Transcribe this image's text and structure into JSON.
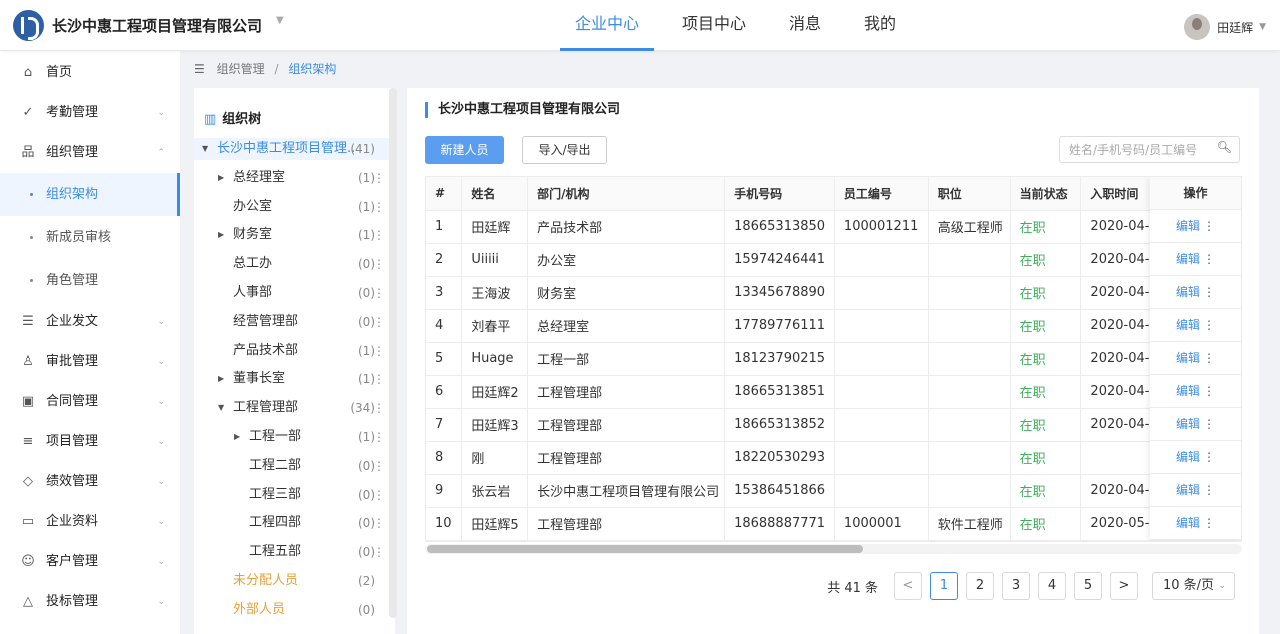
{
  "header": {
    "company": "长沙中惠工程项目管理有限公司",
    "nav": [
      "企业中心",
      "项目中心",
      "消息",
      "我的"
    ],
    "active_nav": 0,
    "user_name": "田廷辉"
  },
  "sidebar": {
    "items": [
      {
        "label": "首页",
        "icon": "home-icon",
        "glyph": "⌂",
        "arrow": ""
      },
      {
        "label": "考勤管理",
        "icon": "check-circle-icon",
        "glyph": "✓",
        "arrow": "⌄"
      },
      {
        "label": "组织管理",
        "icon": "org-chart-icon",
        "glyph": "品",
        "arrow": "⌃"
      }
    ],
    "sub_items": [
      {
        "label": "组织架构",
        "active": true
      },
      {
        "label": "新成员审核",
        "active": false
      },
      {
        "label": "角色管理",
        "active": false
      }
    ],
    "items_after": [
      {
        "label": "企业发文",
        "icon": "document-icon",
        "glyph": "☰",
        "arrow": "⌄"
      },
      {
        "label": "审批管理",
        "icon": "stamp-icon",
        "glyph": "♙",
        "arrow": "⌄"
      },
      {
        "label": "合同管理",
        "icon": "contract-icon",
        "glyph": "▣",
        "arrow": "⌄"
      },
      {
        "label": "项目管理",
        "icon": "list-icon",
        "glyph": "≡",
        "arrow": "⌄"
      },
      {
        "label": "绩效管理",
        "icon": "diamond-icon",
        "glyph": "◇",
        "arrow": "⌄"
      },
      {
        "label": "企业资料",
        "icon": "folder-icon",
        "glyph": "▭",
        "arrow": "⌄"
      },
      {
        "label": "客户管理",
        "icon": "customer-icon",
        "glyph": "☺",
        "arrow": "⌄"
      },
      {
        "label": "投标管理",
        "icon": "warning-icon",
        "glyph": "△",
        "arrow": "⌄"
      }
    ]
  },
  "breadcrumb": {
    "parent": "组织管理",
    "separator": "/",
    "current": "组织架构"
  },
  "tree": {
    "title": "组织树",
    "nodes": [
      {
        "label": "长沙中惠工程项目管理..",
        "count": "(41)",
        "level": 0,
        "arrow": "▼",
        "active": true,
        "orange": false,
        "more": false
      },
      {
        "label": "总经理室",
        "count": "(1)",
        "level": 1,
        "arrow": "▶",
        "active": false,
        "orange": false,
        "more": true
      },
      {
        "label": "办公室",
        "count": "(1)",
        "level": 1,
        "arrow": "",
        "active": false,
        "orange": false,
        "more": true
      },
      {
        "label": "财务室",
        "count": "(1)",
        "level": 1,
        "arrow": "▶",
        "active": false,
        "orange": false,
        "more": true
      },
      {
        "label": "总工办",
        "count": "(0)",
        "level": 1,
        "arrow": "",
        "active": false,
        "orange": false,
        "more": true
      },
      {
        "label": "人事部",
        "count": "(0)",
        "level": 1,
        "arrow": "",
        "active": false,
        "orange": false,
        "more": true
      },
      {
        "label": "经营管理部",
        "count": "(0)",
        "level": 1,
        "arrow": "",
        "active": false,
        "orange": false,
        "more": true
      },
      {
        "label": "产品技术部",
        "count": "(1)",
        "level": 1,
        "arrow": "",
        "active": false,
        "orange": false,
        "more": true
      },
      {
        "label": "董事长室",
        "count": "(1)",
        "level": 1,
        "arrow": "▶",
        "active": false,
        "orange": false,
        "more": true
      },
      {
        "label": "工程管理部",
        "count": "(34)",
        "level": 1,
        "arrow": "▼",
        "active": false,
        "orange": false,
        "more": true
      },
      {
        "label": "工程一部",
        "count": "(1)",
        "level": 2,
        "arrow": "▶",
        "active": false,
        "orange": false,
        "more": true
      },
      {
        "label": "工程二部",
        "count": "(0)",
        "level": 2,
        "arrow": "",
        "active": false,
        "orange": false,
        "more": true
      },
      {
        "label": "工程三部",
        "count": "(0)",
        "level": 2,
        "arrow": "",
        "active": false,
        "orange": false,
        "more": true
      },
      {
        "label": "工程四部",
        "count": "(0)",
        "level": 2,
        "arrow": "",
        "active": false,
        "orange": false,
        "more": true
      },
      {
        "label": "工程五部",
        "count": "(0)",
        "level": 2,
        "arrow": "",
        "active": false,
        "orange": false,
        "more": true
      },
      {
        "label": "未分配人员",
        "count": "(2)",
        "level": 1,
        "arrow": "",
        "active": false,
        "orange": true,
        "more": false
      },
      {
        "label": "外部人员",
        "count": "(0)",
        "level": 1,
        "arrow": "",
        "active": false,
        "orange": true,
        "more": false
      }
    ]
  },
  "main": {
    "title": "长沙中惠工程项目管理有限公司",
    "new_button": "新建人员",
    "import_button": "导入/导出",
    "search_placeholder": "姓名/手机号码/员工编号",
    "columns": [
      "#",
      "姓名",
      "部门/机构",
      "手机号码",
      "员工编号",
      "职位",
      "当前状态",
      "入职时间"
    ],
    "op_column": "操作",
    "edit_label": "编辑",
    "more_label": "⋮",
    "rows": [
      [
        "1",
        "田廷辉",
        "产品技术部",
        "18665313850",
        "100001211",
        "高级工程师",
        "在职",
        "2020-04-"
      ],
      [
        "2",
        "Uiiiii",
        "办公室",
        "15974246441",
        "",
        "",
        "在职",
        "2020-04-"
      ],
      [
        "3",
        "王海波",
        "财务室",
        "13345678890",
        "",
        "",
        "在职",
        "2020-04-"
      ],
      [
        "4",
        "刘春平",
        "总经理室",
        "17789776111",
        "",
        "",
        "在职",
        "2020-04-"
      ],
      [
        "5",
        "Huage",
        "工程一部",
        "18123790215",
        "",
        "",
        "在职",
        "2020-04-"
      ],
      [
        "6",
        "田廷辉2",
        "工程管理部",
        "18665313851",
        "",
        "",
        "在职",
        "2020-04-"
      ],
      [
        "7",
        "田廷辉3",
        "工程管理部",
        "18665313852",
        "",
        "",
        "在职",
        "2020-04-"
      ],
      [
        "8",
        "刚",
        "工程管理部",
        "18220530293",
        "",
        "",
        "在职",
        ""
      ],
      [
        "9",
        "张云岩",
        "长沙中惠工程项目管理有限公司",
        "15386451866",
        "",
        "",
        "在职",
        "2020-04-"
      ],
      [
        "10",
        "田廷辉5",
        "工程管理部",
        "18688887771",
        "1000001",
        "软件工程师",
        "在职",
        "2020-05-"
      ]
    ]
  },
  "pagination": {
    "total": "共 41 条",
    "prev": "<",
    "next": ">",
    "pages": [
      "1",
      "2",
      "3",
      "4",
      "5"
    ],
    "current": "1",
    "page_size": "10 条/页"
  },
  "colors": {
    "accent": "#3c8ce7",
    "status_active": "#3fae5d",
    "unassigned": "#e8a13a"
  }
}
